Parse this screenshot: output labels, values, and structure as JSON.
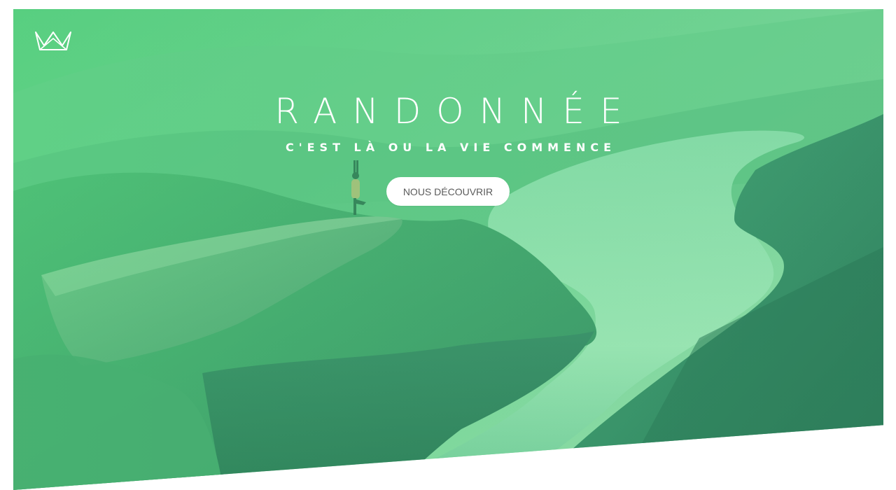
{
  "hero": {
    "title": "RANDONNÉE",
    "subtitle": "C'EST LÀ OU LA VIE COMMENCE",
    "cta_label": "NOUS DÉCOUVRIR",
    "overlay_color": "#3fcf7a",
    "background_scene": "fjord-cliff-with-person-doing-yoga"
  },
  "logo": {
    "icon": "crown-icon"
  },
  "colors": {
    "page_background": "#ffffff",
    "overlay_top": "#5dd38a",
    "overlay_bottom": "#2f8a63",
    "water": "#9be6b4",
    "button_text": "#5b5b5b"
  }
}
